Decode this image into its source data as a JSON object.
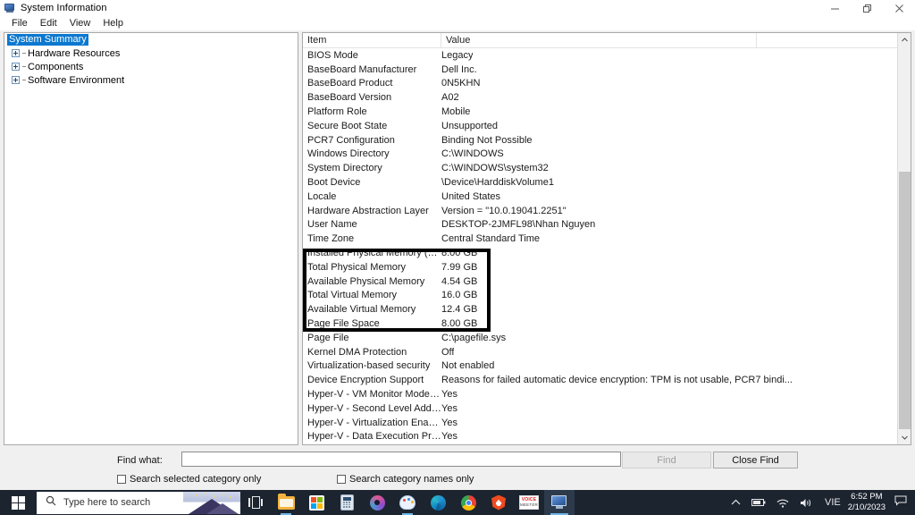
{
  "window": {
    "title": "System Information",
    "icon": "system-information-icon",
    "controls": {
      "minimize": "–",
      "restore": "❐",
      "close": "✕"
    }
  },
  "menu": {
    "items": [
      "File",
      "Edit",
      "View",
      "Help"
    ]
  },
  "tree": {
    "selected": "System Summary",
    "items": [
      {
        "label": "System Summary",
        "expandable": false,
        "selected": true
      },
      {
        "label": "Hardware Resources",
        "expandable": true,
        "selected": false
      },
      {
        "label": "Components",
        "expandable": true,
        "selected": false
      },
      {
        "label": "Software Environment",
        "expandable": true,
        "selected": false
      }
    ]
  },
  "list": {
    "columns": [
      "Item",
      "Value",
      ""
    ],
    "rows": [
      {
        "item": "BIOS Mode",
        "value": "Legacy"
      },
      {
        "item": "BaseBoard Manufacturer",
        "value": "Dell Inc."
      },
      {
        "item": "BaseBoard Product",
        "value": "0N5KHN"
      },
      {
        "item": "BaseBoard Version",
        "value": "A02"
      },
      {
        "item": "Platform Role",
        "value": "Mobile"
      },
      {
        "item": "Secure Boot State",
        "value": "Unsupported"
      },
      {
        "item": "PCR7 Configuration",
        "value": "Binding Not Possible"
      },
      {
        "item": "Windows Directory",
        "value": "C:\\WINDOWS"
      },
      {
        "item": "System Directory",
        "value": "C:\\WINDOWS\\system32"
      },
      {
        "item": "Boot Device",
        "value": "\\Device\\HarddiskVolume1"
      },
      {
        "item": "Locale",
        "value": "United States"
      },
      {
        "item": "Hardware Abstraction Layer",
        "value": "Version = \"10.0.19041.2251\""
      },
      {
        "item": "User Name",
        "value": "DESKTOP-2JMFL98\\Nhan Nguyen"
      },
      {
        "item": "Time Zone",
        "value": "Central Standard Time"
      },
      {
        "item": "Installed Physical Memory (RAM)",
        "value": "8.00 GB",
        "highlighted": true
      },
      {
        "item": "Total Physical Memory",
        "value": "7.99 GB",
        "highlighted": true
      },
      {
        "item": "Available Physical Memory",
        "value": "4.54 GB",
        "highlighted": true
      },
      {
        "item": "Total Virtual Memory",
        "value": "16.0 GB",
        "highlighted": true
      },
      {
        "item": "Available Virtual Memory",
        "value": "12.4 GB",
        "highlighted": true
      },
      {
        "item": "Page File Space",
        "value": "8.00 GB",
        "highlighted": true
      },
      {
        "item": "Page File",
        "value": "C:\\pagefile.sys"
      },
      {
        "item": "Kernel DMA Protection",
        "value": "Off"
      },
      {
        "item": "Virtualization-based security",
        "value": "Not enabled"
      },
      {
        "item": "Device Encryption Support",
        "value": "Reasons for failed automatic device encryption: TPM is not usable, PCR7 bindi..."
      },
      {
        "item": "Hyper-V - VM Monitor Mode E...",
        "value": "Yes"
      },
      {
        "item": "Hyper-V - Second Level Addres...",
        "value": "Yes"
      },
      {
        "item": "Hyper-V - Virtualization Enable...",
        "value": "Yes"
      },
      {
        "item": "Hyper-V - Data Execution Prote...",
        "value": "Yes"
      }
    ],
    "annotation": {
      "color": "#000000",
      "from_row": "Installed Physical Memory (RAM)",
      "to_row": "Page File Space"
    },
    "scrollbar": {
      "up_arrow": "▲",
      "down_arrow": "▼"
    }
  },
  "findbar": {
    "label": "Find what:",
    "input_value": "",
    "input_placeholder": "",
    "find_button": "Find",
    "find_button_enabled": false,
    "close_button": "Close Find",
    "checkbox_selected_category": {
      "label": "Search selected category only",
      "checked": false
    },
    "checkbox_category_names": {
      "label": "Search category names only",
      "checked": false
    }
  },
  "taskbar": {
    "search_placeholder": "Type here to search",
    "apps": [
      {
        "name": "task-view",
        "label": "Task View"
      },
      {
        "name": "file-explorer",
        "label": "File Explorer"
      },
      {
        "name": "microsoft-store",
        "label": "Microsoft Store"
      },
      {
        "name": "calculator",
        "label": "Calculator"
      },
      {
        "name": "media-player",
        "label": "Media Player"
      },
      {
        "name": "paint",
        "label": "Paint"
      },
      {
        "name": "microsoft-edge",
        "label": "Microsoft Edge"
      },
      {
        "name": "google-chrome",
        "label": "Google Chrome"
      },
      {
        "name": "brave-browser",
        "label": "Brave"
      },
      {
        "name": "voicemeeter",
        "label": "VOICEMEETER"
      },
      {
        "name": "system-information",
        "label": "System Information"
      }
    ],
    "voicemeeter_top": "VOICE",
    "voicemeeter_bottom": "MEETER",
    "tray": {
      "language": "VIE",
      "time": "6:52 PM",
      "date": "2/10/2023",
      "chevron": "⌃"
    }
  }
}
